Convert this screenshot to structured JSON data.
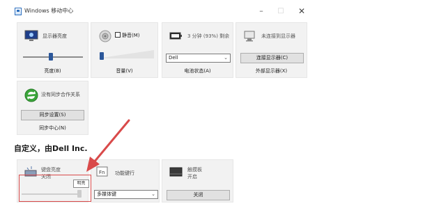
{
  "window": {
    "title": "Windows 移动中心",
    "min_glyph": "–",
    "max_glyph": "□",
    "close_glyph": "✕"
  },
  "tiles": {
    "brightness": {
      "title": "显示器亮度",
      "footer": "亮度(B)",
      "level": 0.46,
      "icon": "monitor-brightness-icon"
    },
    "volume": {
      "mute_label": "静音(M)",
      "muted": false,
      "footer": "音量(V)",
      "level": 0.05,
      "icon": "speaker-icon"
    },
    "battery": {
      "title": "3 分钟 (93%) 剩余",
      "plan": "Dell",
      "footer": "电池状态(A)",
      "icon": "battery-icon"
    },
    "external_display": {
      "title": "未连接到显示器",
      "button": "连接显示器(C)",
      "footer": "外部显示器(X)",
      "icon": "projector-icon"
    },
    "sync": {
      "title": "没有同步合作关系",
      "button": "同步设置(S)",
      "footer": "同步中心(N)",
      "icon": "sync-icon"
    },
    "keyboard_backlight": {
      "title": "键盘亮度",
      "status": "关闭",
      "tooltip": "明亮",
      "level": 1.0,
      "icon": "keyboard-backlight-icon"
    },
    "fn_keys": {
      "title": "功能键行",
      "option": "多媒体键",
      "icon": "fn-key-icon"
    },
    "touchpad": {
      "title": "触摸板",
      "status": "开启",
      "button": "关闭",
      "icon": "touchpad-icon"
    }
  },
  "custom_section": {
    "heading": "自定义，由Dell Inc."
  },
  "colors": {
    "tile_bg": "#f2f2f2",
    "accent": "#2b579a",
    "annotation": "#d94a4a"
  }
}
